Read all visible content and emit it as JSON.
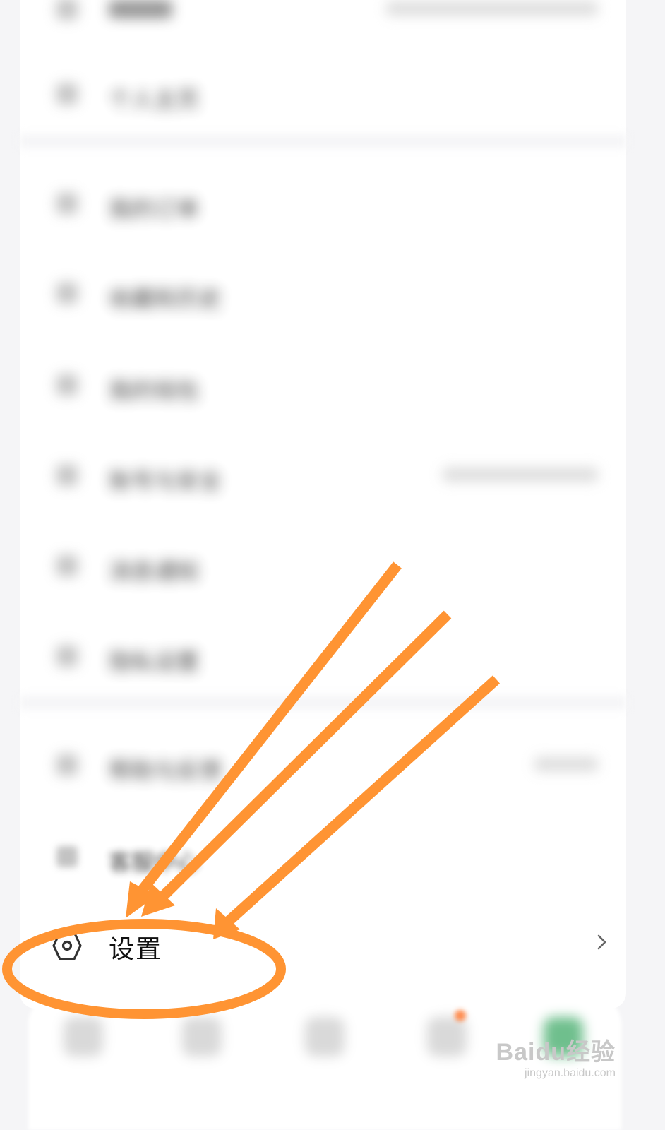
{
  "settings": {
    "label": "设置",
    "icon": "hexagon-gear-icon",
    "chevron": "chevron-right-icon"
  },
  "blurred_rows": [
    {
      "label": "个人主页",
      "value": ""
    },
    {
      "label": "我的订单",
      "value": ""
    },
    {
      "label": "收藏和历史",
      "value": ""
    },
    {
      "label": "我的钱包",
      "value": ""
    },
    {
      "label": "账号与安全",
      "value": ""
    },
    {
      "label": "消息通知",
      "value": ""
    },
    {
      "label": "隐私设置",
      "value": ""
    },
    {
      "label": "帮助与反馈",
      "value": ""
    },
    {
      "label": "客服中心",
      "value": ""
    }
  ],
  "watermark": {
    "logo": "Baidu经验",
    "url": "jingyan.baidu.com"
  },
  "annotation_color": "#ff9433"
}
